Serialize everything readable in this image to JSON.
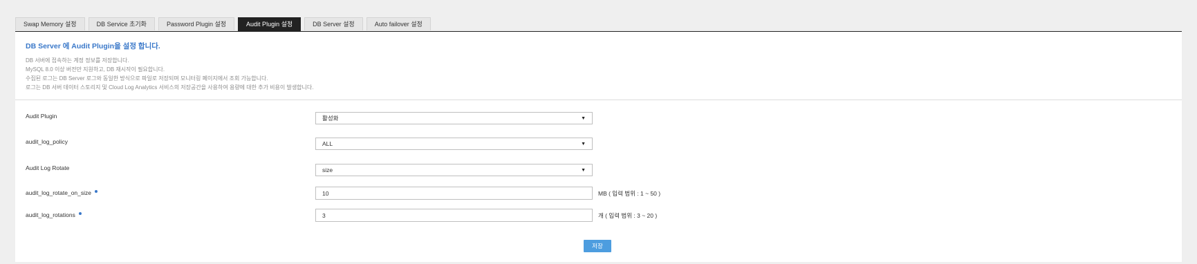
{
  "tabs": [
    {
      "label": "Swap Memory 설정",
      "active": false
    },
    {
      "label": "DB Service 초기화",
      "active": false
    },
    {
      "label": "Password Plugin 설정",
      "active": false
    },
    {
      "label": "Audit Plugin 설정",
      "active": true
    },
    {
      "label": "DB Server 설정",
      "active": false
    },
    {
      "label": "Auto failover 설정",
      "active": false
    }
  ],
  "header": {
    "title": "DB Server 에 Audit Plugin을 설정 합니다.",
    "descriptions": [
      "DB 서버에 접속하는 계정 정보를 저장합니다.",
      "MySQL 8.0 이상 버전만 지원하고, DB 재시작이 필요합니다.",
      "수집된 로그는 DB Server 로그와 동일한 방식으로 파일로 저장되며 모니터링 페이지에서 조회 가능합니다.",
      "로그는 DB 서버 데이터 스토리지 및 Cloud Log Analytics 서비스의 저장공간을 사용하여 용량에 대한 추가 비용이 발생합니다."
    ]
  },
  "form": {
    "audit_plugin": {
      "label": "Audit Plugin",
      "value": "활성화"
    },
    "audit_log_policy": {
      "label": "audit_log_policy",
      "value": "ALL"
    },
    "audit_log_rotate": {
      "label": "Audit Log Rotate",
      "value": "size"
    },
    "audit_log_rotate_on_size": {
      "label": "audit_log_rotate_on_size",
      "value": "10",
      "unit": "MB ( 입력 범위 : 1 ~ 50 )",
      "required": true
    },
    "audit_log_rotations": {
      "label": "audit_log_rotations",
      "value": "3",
      "unit": "개 ( 입력 범위 : 3 ~ 20 )",
      "required": true
    }
  },
  "save_label": "저장",
  "icons": {
    "dropdown": "caret-down-icon",
    "required": "required-dot-icon"
  },
  "colors": {
    "accent": "#3a78c9",
    "active_tab": "#222222",
    "button": "#4d9ddf"
  }
}
